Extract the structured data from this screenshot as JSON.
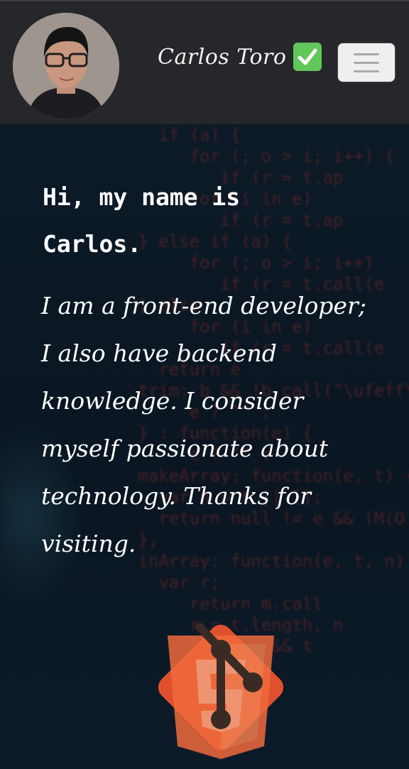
{
  "header": {
    "brand_name": "Carlos Toro",
    "verified_icon": "check-mark-button-icon",
    "menu_icon": "hamburger-menu-icon"
  },
  "hero": {
    "greeting": "Hi, my name is Carlos.",
    "bio": "I am a front-end developer; I also have backend knowledge. I consider myself passionate about technology. Thanks for visiting.",
    "logo_icons": [
      "git-icon",
      "html5-icon"
    ]
  },
  "colors": {
    "navbar": "#25272b",
    "verified": "#61c75a",
    "text": "#ffffff",
    "git_logo": "#e0502f"
  }
}
